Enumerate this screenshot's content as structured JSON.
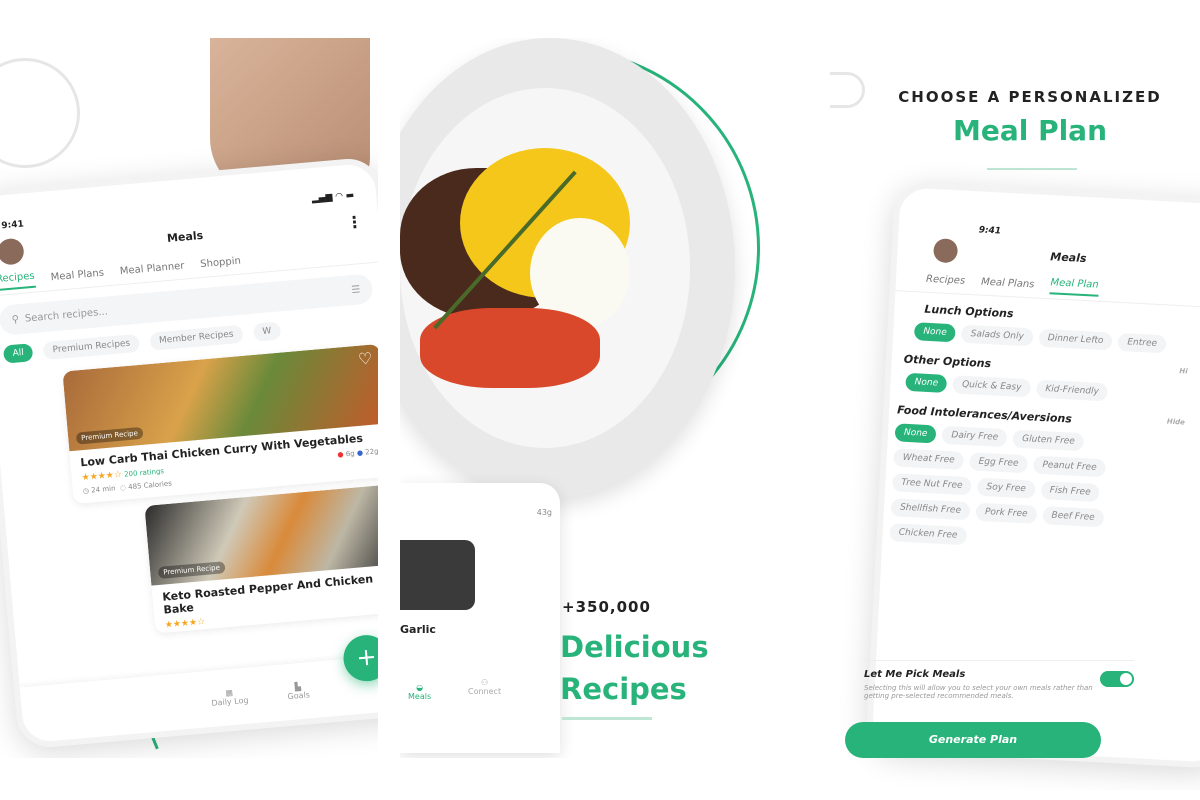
{
  "recipes_screen": {
    "time": "9:41",
    "title": "Meals",
    "tabs": [
      "Recipes",
      "Meal Plans",
      "Meal Planner",
      "Shoppin"
    ],
    "search_placeholder": "Search recipes...",
    "filters": [
      "All",
      "Premium Recipes",
      "Member Recipes",
      "W"
    ],
    "recipes": [
      {
        "badge": "Premium Recipe",
        "title": "Low Carb Thai Chicken Curry With Vegetables",
        "rating": 4,
        "ratings": "200 ratings",
        "time": "24 min",
        "calories": "485 Calories",
        "carbs": "6g",
        "protein": "22g"
      },
      {
        "badge": "Premium Recipe",
        "title": "Keto Roasted Pepper And Chicken Bake",
        "rating": 4
      }
    ],
    "nav": [
      "Daily Log",
      "Goals",
      "Meals",
      "Connect"
    ],
    "fab": "+",
    "partial": {
      "macro": "43g",
      "title": "Garlic"
    }
  },
  "promo_recipes": {
    "count": "+350,000",
    "headline_1": "Delicious",
    "headline_2": "Recipes"
  },
  "promo_plan": {
    "kicker": "CHOOSE A PERSONALIZED",
    "headline": "Meal Plan"
  },
  "plan_screen": {
    "time": "9:41",
    "title": "Meals",
    "tabs": [
      "Recipes",
      "Meal Plans",
      "Meal Plan"
    ],
    "lunch": {
      "label": "Lunch Options",
      "options": [
        "None",
        "Salads Only",
        "Dinner Lefto",
        "Entree"
      ],
      "selected": 0
    },
    "other": {
      "label": "Other Options",
      "hint": "Hi",
      "options": [
        "None",
        "Quick & Easy",
        "Kid-Friendly"
      ],
      "selected": 0
    },
    "intolerances": {
      "label": "Food Intolerances/Aversions",
      "hint": "Hide",
      "options": [
        "None",
        "Dairy Free",
        "Gluten Free",
        "Wheat Free",
        "Egg Free",
        "Peanut Free",
        "Tree Nut Free",
        "Soy Free",
        "Fish Free",
        "Shellfish Free",
        "Pork Free",
        "Beef Free",
        "Chicken Free"
      ],
      "selected": 0
    },
    "pick": {
      "label": "Let Me Pick Meals",
      "desc": "Selecting this will allow you to select your own meals rather than getting pre-selected recommended meals.",
      "on": true
    },
    "generate": "Generate Plan"
  },
  "colors": {
    "accent": "#27b37a"
  }
}
